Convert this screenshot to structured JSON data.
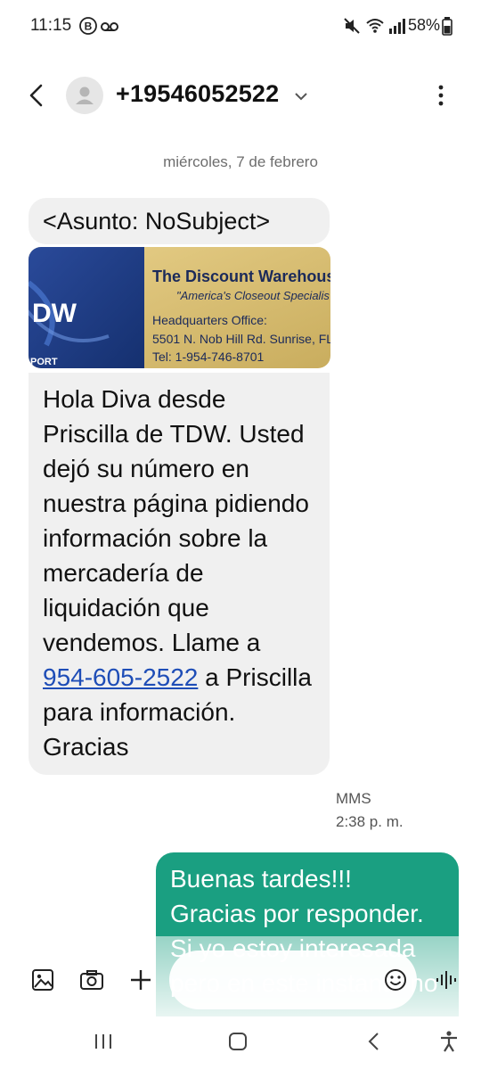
{
  "status_bar": {
    "time": "11:15",
    "battery": "58%",
    "icons": [
      "b-circle-icon",
      "voicemail-icon",
      "mute-icon",
      "wifi-icon",
      "signal-icon",
      "battery-icon"
    ]
  },
  "header": {
    "contact": "+19546052522",
    "icons": {
      "back": "back-arrow-icon",
      "avatar": "avatar-icon",
      "expand": "chevron-down-icon",
      "more": "more-options-icon"
    }
  },
  "conversation": {
    "date": "miércoles, 7 de febrero",
    "incoming": {
      "subject": "<Asunto: NoSubject>",
      "image": {
        "title": "The Discount Warehouse",
        "subtitle": "\"America's Closeout Specialis",
        "line1": "Headquarters Office:",
        "line2": "5501 N. Nob Hill Rd. Sunrise, FL",
        "line3": "Tel: 1-954-746-8701",
        "logo_text": "DW",
        "logo_sub": "PORT"
      },
      "text_before_link": "Hola Diva desde Priscilla de TDW. Usted dejó su número en nuestra página pidiendo información sobre la mercadería de liquidación que vendemos.  Llame a ",
      "link": "954-605-2522",
      "text_after_link": " a Priscilla para información. Gracias",
      "type": "MMS",
      "time": "2:38 p. m."
    },
    "outgoing": {
      "text": "Buenas tardes!!! Gracias por responder. Si yo estoy interesada pero en este instante no"
    }
  },
  "composer": {
    "icons": [
      "gallery-icon",
      "camera-icon",
      "plus-icon",
      "emoji-icon",
      "voice-icon"
    ]
  },
  "nav_bar": {
    "icons": [
      "recent-apps-icon",
      "home-icon",
      "back-icon",
      "accessibility-icon"
    ]
  },
  "colors": {
    "outgoing_bubble": "#1a9f81",
    "incoming_bubble": "#f0f0f0",
    "link": "#1e4db7"
  }
}
